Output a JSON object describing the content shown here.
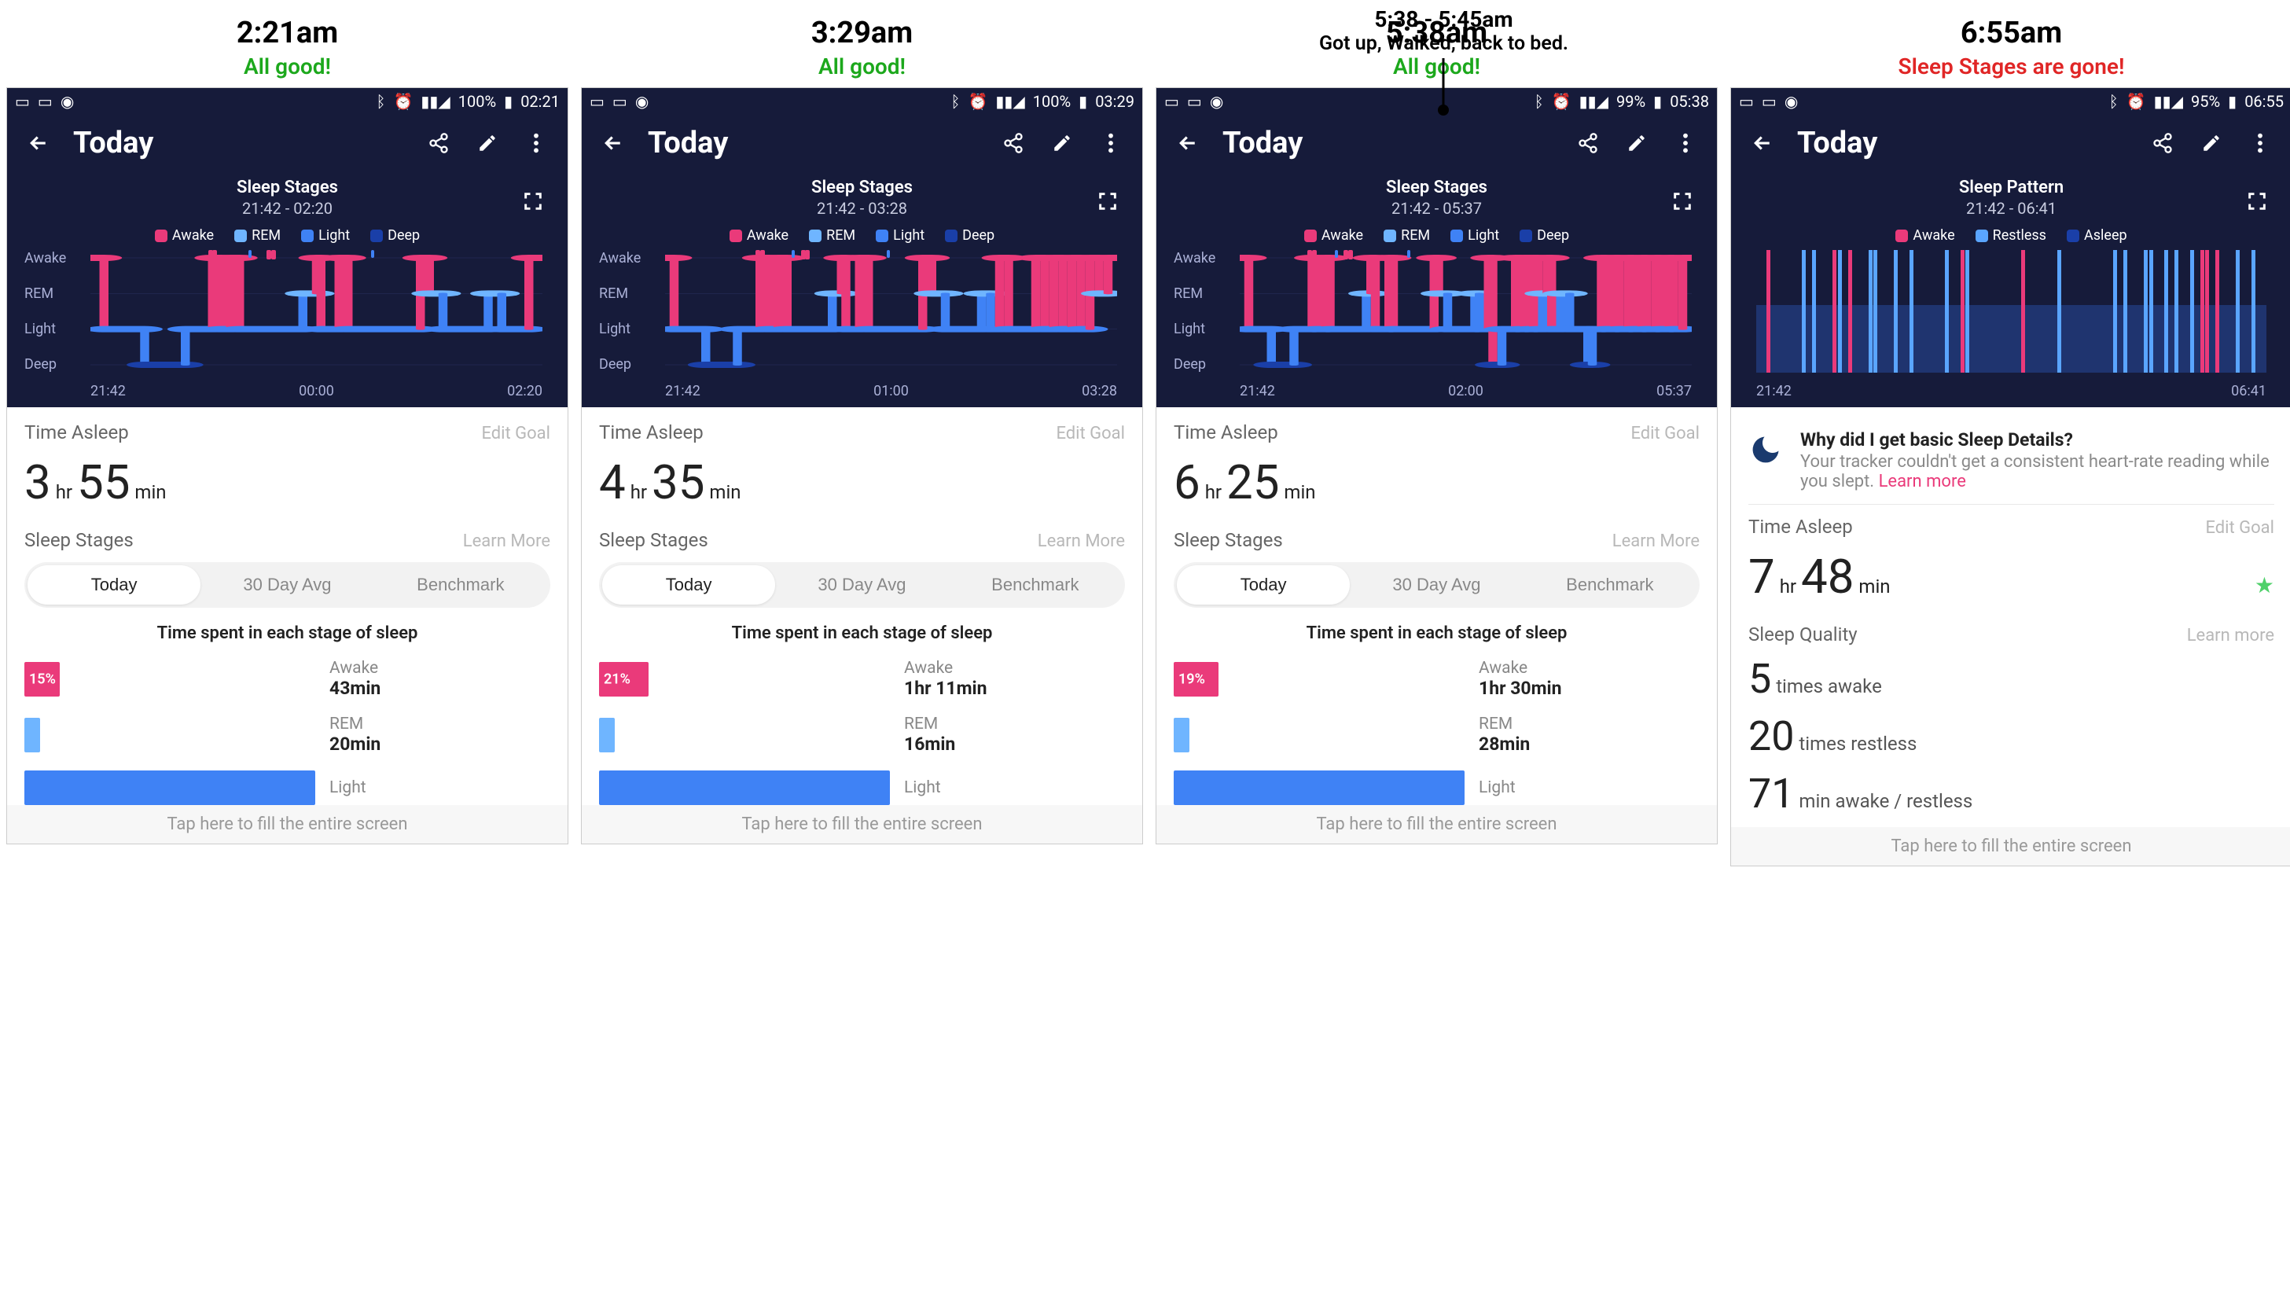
{
  "annotation": {
    "top_line1": "5:38 - 5:45am",
    "top_line2": "Got up, Walked, back to bed."
  },
  "cols": [
    {
      "caption_time": "2:21am",
      "caption_status": "All good!",
      "caption_class": "green",
      "status_battery": "100%",
      "status_time": "02:21",
      "app_title": "Today",
      "chart_title": "Sleep Stages",
      "chart_range": "21:42 - 02:20",
      "legend_mode": "stages",
      "x_start": "21:42",
      "x_mid": "00:00",
      "x_end": "02:20",
      "time_asleep_hr": "3",
      "time_asleep_min": "55",
      "edit_goal": "Edit Goal",
      "section2": "Sleep Stages",
      "learn": "Learn More",
      "seg": [
        "Today",
        "30 Day Avg",
        "Benchmark"
      ],
      "subhead": "Time spent in each stage of sleep",
      "awake_pct": "15%",
      "awake_dur": "43min",
      "rem_dur": "20min",
      "light_dur": "",
      "footer": "Tap here to fill the entire screen",
      "type": "stages"
    },
    {
      "caption_time": "3:29am",
      "caption_status": "All good!",
      "caption_class": "green",
      "status_battery": "100%",
      "status_time": "03:29",
      "app_title": "Today",
      "chart_title": "Sleep Stages",
      "chart_range": "21:42 - 03:28",
      "x_start": "21:42",
      "x_mid": "01:00",
      "x_end": "03:28",
      "time_asleep_hr": "4",
      "time_asleep_min": "35",
      "edit_goal": "Edit Goal",
      "section2": "Sleep Stages",
      "learn": "Learn More",
      "seg": [
        "Today",
        "30 Day Avg",
        "Benchmark"
      ],
      "subhead": "Time spent in each stage of sleep",
      "awake_pct": "21%",
      "awake_dur": "1hr 11min",
      "rem_dur": "16min",
      "footer": "Tap here to fill the entire screen",
      "type": "stages"
    },
    {
      "caption_time": "5:38am",
      "caption_status": "All good!",
      "caption_class": "green",
      "status_battery": "99%",
      "status_time": "05:38",
      "app_title": "Today",
      "chart_title": "Sleep Stages",
      "chart_range": "21:42 - 05:37",
      "x_start": "21:42",
      "x_mid": "02:00",
      "x_end": "05:37",
      "time_asleep_hr": "6",
      "time_asleep_min": "25",
      "edit_goal": "Edit Goal",
      "section2": "Sleep Stages",
      "learn": "Learn More",
      "seg": [
        "Today",
        "30 Day Avg",
        "Benchmark"
      ],
      "subhead": "Time spent in each stage of sleep",
      "awake_pct": "19%",
      "awake_dur": "1hr 30min",
      "rem_dur": "28min",
      "footer": "Tap here to fill the entire screen",
      "type": "stages"
    },
    {
      "caption_time": "6:55am",
      "caption_status": "Sleep Stages are gone!",
      "caption_class": "red",
      "status_battery": "95%",
      "status_time": "06:55",
      "app_title": "Today",
      "chart_title": "Sleep Pattern",
      "chart_range": "21:42 - 06:41",
      "x_start": "21:42",
      "x_mid": "",
      "x_end": "06:41",
      "notice_title": "Why did I get basic Sleep Details?",
      "notice_body": "Your tracker couldn't get a consistent heart-rate reading while you slept. ",
      "notice_link": "Learn more",
      "time_asleep_hr": "7",
      "time_asleep_min": "48",
      "edit_goal": "Edit Goal",
      "sq_label": "Sleep Quality",
      "sq_learn": "Learn more",
      "sq_awake_n": "5",
      "sq_awake_t": " times awake",
      "sq_rest_n": "20",
      "sq_rest_t": " times restless",
      "sq_min_n": "71",
      "sq_min_t": " min awake / restless",
      "footer": "Tap here to fill the entire screen",
      "type": "pattern"
    }
  ],
  "labels": {
    "time_asleep": "Time Asleep",
    "hr": " hr ",
    "min": " min",
    "awake": "Awake",
    "rem": "REM",
    "light": "Light",
    "deep": "Deep",
    "restless": "Restless",
    "asleep": "Asleep",
    "ylabels": [
      "Awake",
      "REM",
      "Light",
      "Deep"
    ]
  },
  "colors": {
    "awake": "#ea3a7a",
    "rem": "#6fb5ff",
    "light": "#3f82f5",
    "deep": "#1a3fa8"
  },
  "chart_data": [
    {
      "type": "step",
      "stages": [
        "Awake",
        "REM",
        "Light",
        "Deep"
      ],
      "segments": [
        {
          "x": 0,
          "w": 3,
          "lvl": 0
        },
        {
          "x": 3,
          "w": 9,
          "lvl": 2
        },
        {
          "x": 12,
          "w": 9,
          "lvl": 3
        },
        {
          "x": 21,
          "w": 6,
          "lvl": 2
        },
        {
          "x": 27,
          "w": 2,
          "lvl": 0
        },
        {
          "x": 29,
          "w": 2,
          "lvl": 2
        },
        {
          "x": 31,
          "w": 2,
          "lvl": 0
        },
        {
          "x": 33,
          "w": 14,
          "lvl": 2
        },
        {
          "x": 47,
          "w": 3,
          "lvl": 1
        },
        {
          "x": 50,
          "w": 1,
          "lvl": 0
        },
        {
          "x": 51,
          "w": 4,
          "lvl": 2
        },
        {
          "x": 55,
          "w": 2,
          "lvl": 0
        },
        {
          "x": 57,
          "w": 16,
          "lvl": 2
        },
        {
          "x": 73,
          "w": 2,
          "lvl": 0
        },
        {
          "x": 75,
          "w": 3,
          "lvl": 1
        },
        {
          "x": 78,
          "w": 10,
          "lvl": 2
        },
        {
          "x": 88,
          "w": 3,
          "lvl": 1
        },
        {
          "x": 91,
          "w": 6,
          "lvl": 2
        },
        {
          "x": 97,
          "w": 3,
          "lvl": 0
        }
      ],
      "ticks_awake": [
        26,
        27,
        39,
        40
      ],
      "ticks_rem": [
        35,
        62
      ]
    },
    {
      "type": "step",
      "segments": [
        {
          "x": 0,
          "w": 2,
          "lvl": 0
        },
        {
          "x": 2,
          "w": 7,
          "lvl": 2
        },
        {
          "x": 9,
          "w": 7,
          "lvl": 3
        },
        {
          "x": 16,
          "w": 5,
          "lvl": 2
        },
        {
          "x": 21,
          "w": 2,
          "lvl": 0
        },
        {
          "x": 23,
          "w": 2,
          "lvl": 2
        },
        {
          "x": 25,
          "w": 2,
          "lvl": 0
        },
        {
          "x": 27,
          "w": 10,
          "lvl": 2
        },
        {
          "x": 37,
          "w": 2,
          "lvl": 1
        },
        {
          "x": 39,
          "w": 1,
          "lvl": 0
        },
        {
          "x": 40,
          "w": 3,
          "lvl": 2
        },
        {
          "x": 43,
          "w": 2,
          "lvl": 0
        },
        {
          "x": 45,
          "w": 12,
          "lvl": 2
        },
        {
          "x": 57,
          "w": 2,
          "lvl": 0
        },
        {
          "x": 59,
          "w": 3,
          "lvl": 1
        },
        {
          "x": 62,
          "w": 8,
          "lvl": 2
        },
        {
          "x": 70,
          "w": 2,
          "lvl": 1
        },
        {
          "x": 72,
          "w": 2,
          "lvl": 2
        },
        {
          "x": 74,
          "w": 2,
          "lvl": 0
        },
        {
          "x": 76,
          "w": 6,
          "lvl": 2
        },
        {
          "x": 82,
          "w": 2,
          "lvl": 0
        },
        {
          "x": 84,
          "w": 2,
          "lvl": 2
        },
        {
          "x": 86,
          "w": 2,
          "lvl": 0
        },
        {
          "x": 88,
          "w": 2,
          "lvl": 2
        },
        {
          "x": 90,
          "w": 2,
          "lvl": 0
        },
        {
          "x": 92,
          "w": 2,
          "lvl": 2
        },
        {
          "x": 94,
          "w": 2,
          "lvl": 0
        },
        {
          "x": 96,
          "w": 2,
          "lvl": 1
        },
        {
          "x": 98,
          "w": 2,
          "lvl": 0
        }
      ],
      "ticks_awake": [
        20,
        21,
        30,
        31
      ],
      "ticks_rem": [
        28,
        49
      ]
    },
    {
      "type": "step",
      "segments": [
        {
          "x": 0,
          "w": 2,
          "lvl": 0
        },
        {
          "x": 2,
          "w": 5,
          "lvl": 2
        },
        {
          "x": 7,
          "w": 5,
          "lvl": 3
        },
        {
          "x": 12,
          "w": 4,
          "lvl": 2
        },
        {
          "x": 16,
          "w": 1,
          "lvl": 0
        },
        {
          "x": 17,
          "w": 2,
          "lvl": 2
        },
        {
          "x": 19,
          "w": 1,
          "lvl": 0
        },
        {
          "x": 20,
          "w": 8,
          "lvl": 2
        },
        {
          "x": 28,
          "w": 1,
          "lvl": 1
        },
        {
          "x": 29,
          "w": 1,
          "lvl": 0
        },
        {
          "x": 30,
          "w": 3,
          "lvl": 2
        },
        {
          "x": 33,
          "w": 1,
          "lvl": 0
        },
        {
          "x": 34,
          "w": 9,
          "lvl": 2
        },
        {
          "x": 43,
          "w": 1,
          "lvl": 0
        },
        {
          "x": 44,
          "w": 2,
          "lvl": 1
        },
        {
          "x": 46,
          "w": 6,
          "lvl": 2
        },
        {
          "x": 52,
          "w": 1,
          "lvl": 1
        },
        {
          "x": 53,
          "w": 2,
          "lvl": 2
        },
        {
          "x": 55,
          "w": 1,
          "lvl": 0
        },
        {
          "x": 56,
          "w": 2,
          "lvl": 3
        },
        {
          "x": 58,
          "w": 3,
          "lvl": 2
        },
        {
          "x": 61,
          "w": 1,
          "lvl": 0
        },
        {
          "x": 62,
          "w": 1,
          "lvl": 2
        },
        {
          "x": 63,
          "w": 1,
          "lvl": 0
        },
        {
          "x": 64,
          "w": 1,
          "lvl": 2
        },
        {
          "x": 65,
          "w": 1,
          "lvl": 0
        },
        {
          "x": 66,
          "w": 1,
          "lvl": 2
        },
        {
          "x": 67,
          "w": 1,
          "lvl": 1
        },
        {
          "x": 68,
          "w": 1,
          "lvl": 0
        },
        {
          "x": 69,
          "w": 2,
          "lvl": 2
        },
        {
          "x": 71,
          "w": 2,
          "lvl": 1
        },
        {
          "x": 73,
          "w": 4,
          "lvl": 2
        },
        {
          "x": 77,
          "w": 1,
          "lvl": 3
        },
        {
          "x": 78,
          "w": 2,
          "lvl": 2
        },
        {
          "x": 80,
          "w": 1,
          "lvl": 0
        },
        {
          "x": 81,
          "w": 2,
          "lvl": 2
        },
        {
          "x": 83,
          "w": 1,
          "lvl": 0
        },
        {
          "x": 84,
          "w": 2,
          "lvl": 2
        },
        {
          "x": 86,
          "w": 1,
          "lvl": 0
        },
        {
          "x": 87,
          "w": 2,
          "lvl": 2
        },
        {
          "x": 89,
          "w": 1,
          "lvl": 0
        },
        {
          "x": 90,
          "w": 2,
          "lvl": 2
        },
        {
          "x": 92,
          "w": 1,
          "lvl": 0
        },
        {
          "x": 93,
          "w": 2,
          "lvl": 2
        },
        {
          "x": 95,
          "w": 1,
          "lvl": 0
        },
        {
          "x": 96,
          "w": 2,
          "lvl": 2
        },
        {
          "x": 98,
          "w": 2,
          "lvl": 0
        }
      ],
      "ticks_awake": [
        15,
        16,
        23,
        24
      ],
      "ticks_rem": [
        21,
        37
      ]
    },
    {
      "type": "pattern",
      "bars": [
        {
          "x": 2,
          "c": "a"
        },
        {
          "x": 9,
          "c": "r"
        },
        {
          "x": 11,
          "c": "r"
        },
        {
          "x": 15,
          "c": "a"
        },
        {
          "x": 16,
          "c": "r"
        },
        {
          "x": 18,
          "c": "a"
        },
        {
          "x": 22,
          "c": "r"
        },
        {
          "x": 23,
          "c": "r"
        },
        {
          "x": 27,
          "c": "r"
        },
        {
          "x": 30,
          "c": "r"
        },
        {
          "x": 37,
          "c": "r"
        },
        {
          "x": 40,
          "c": "a"
        },
        {
          "x": 41,
          "c": "r"
        },
        {
          "x": 52,
          "c": "a"
        },
        {
          "x": 59,
          "c": "r"
        },
        {
          "x": 70,
          "c": "r"
        },
        {
          "x": 72,
          "c": "r"
        },
        {
          "x": 76,
          "c": "r"
        },
        {
          "x": 77,
          "c": "r"
        },
        {
          "x": 80,
          "c": "r"
        },
        {
          "x": 82,
          "c": "r"
        },
        {
          "x": 85,
          "c": "r"
        },
        {
          "x": 87,
          "c": "a"
        },
        {
          "x": 88,
          "c": "a"
        },
        {
          "x": 90,
          "c": "a"
        },
        {
          "x": 94,
          "c": "r"
        },
        {
          "x": 97,
          "c": "r"
        }
      ]
    }
  ]
}
